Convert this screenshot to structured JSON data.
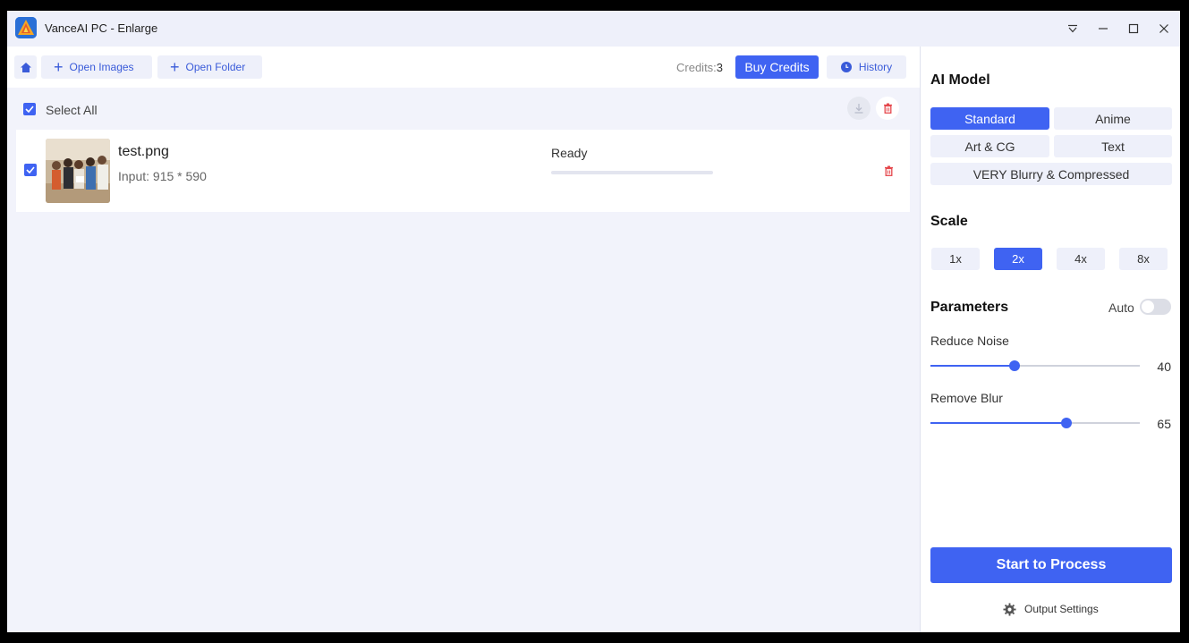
{
  "window": {
    "title": "VanceAI PC - Enlarge"
  },
  "toolbar": {
    "open_images_label": "Open Images",
    "open_folder_label": "Open Folder",
    "credits_label": "Credits:",
    "credits_value": "3",
    "buy_credits_label": "Buy Credits",
    "history_label": "History"
  },
  "list": {
    "select_all_label": "Select All",
    "files": [
      {
        "name": "test.png",
        "input": "Input: 915 * 590",
        "status": "Ready"
      }
    ]
  },
  "panel": {
    "ai_model_title": "AI Model",
    "models": [
      "Standard",
      "Anime",
      "Art & CG",
      "Text",
      "VERY Blurry & Compressed"
    ],
    "selected_model": "Standard",
    "scale_title": "Scale",
    "scales": [
      "1x",
      "2x",
      "4x",
      "8x"
    ],
    "selected_scale": "2x",
    "parameters_title": "Parameters",
    "auto_label": "Auto",
    "auto_enabled": false,
    "reduce_noise_label": "Reduce Noise",
    "reduce_noise_value": "40",
    "remove_blur_label": "Remove Blur",
    "remove_blur_value": "65",
    "start_label": "Start to Process",
    "output_settings_label": "Output Settings"
  },
  "colors": {
    "accent": "#3f63f2",
    "delete": "#e5484d"
  },
  "icons": {
    "home": "home-icon",
    "plus": "plus-icon",
    "clock": "clock-icon",
    "download": "download-icon",
    "trash": "trash-icon",
    "gear": "gear-icon",
    "menu": "dropdown-menu-icon",
    "maximize": "maximize-icon",
    "close": "close-icon"
  }
}
